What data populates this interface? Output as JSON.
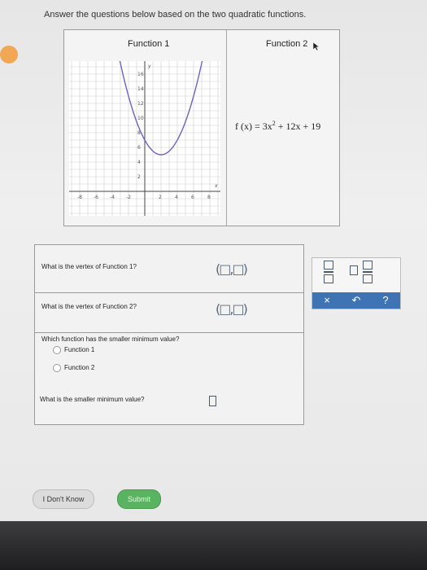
{
  "instructions": "Answer the questions below based on the two quadratic functions.",
  "functions_table": {
    "col1_heading": "Function 1",
    "col2_heading": "Function 2",
    "function2_formula": {
      "lhs": "f (x) = 3x",
      "exponent": "2",
      "rhs": " + 12x + 19"
    },
    "graph": {
      "x_label": "x",
      "y_label": "y",
      "x_ticks": [
        "-8",
        "-6",
        "-4",
        "-2",
        "2",
        "4",
        "6",
        "8"
      ],
      "y_ticks": [
        "2",
        "4",
        "6",
        "8",
        "10",
        "12",
        "14",
        "16"
      ],
      "curve_color": "#6f63c2"
    }
  },
  "questions": {
    "q1": "What is the vertex of Function 1?",
    "q2": "What is the vertex of Function 2?",
    "q3": "Which function has the smaller minimum value?",
    "q3_options": [
      "Function 1",
      "Function 2"
    ],
    "q4": "What is the smaller minimum value?",
    "vertex_placeholder": "(□,□)"
  },
  "toolbar": {
    "clear_label": "×",
    "undo_label": "↶",
    "help_label": "?"
  },
  "footer": {
    "dont_know_label": "I Don't Know",
    "submit_label": "Submit"
  },
  "colors": {
    "accent_blue": "#3f74b4",
    "submit_green": "#59b360",
    "side_dot_orange": "#f29b3a"
  }
}
